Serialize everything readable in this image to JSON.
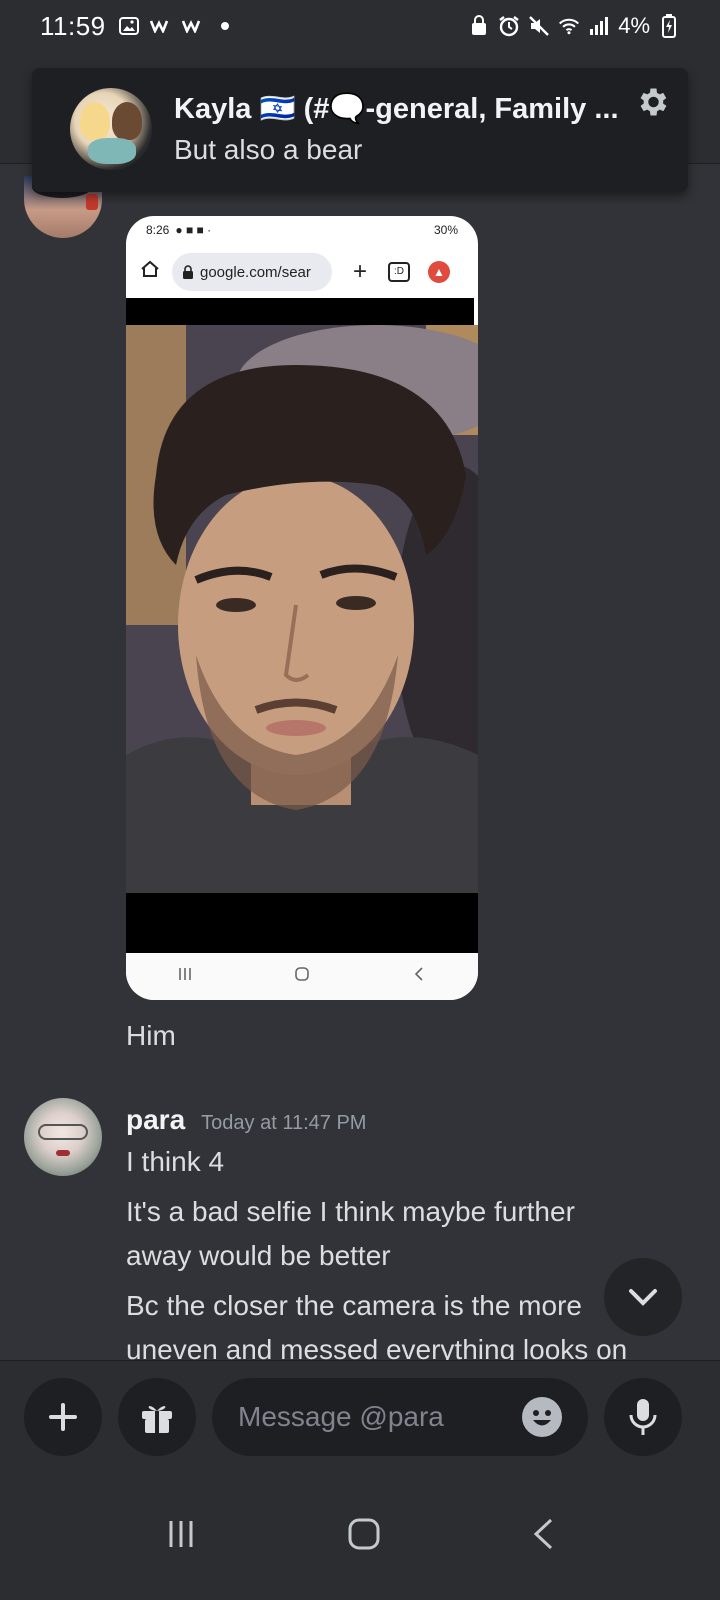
{
  "status_bar": {
    "time": "11:59",
    "battery": "4%"
  },
  "notification": {
    "title": "Kayla 🇮🇱 (#🗨️-general, Family ...",
    "body": "But also a bear"
  },
  "shared_image": {
    "status_time": "8:26",
    "status_battery": "30%",
    "url": "google.com/sear",
    "tabs_label": ":D"
  },
  "messages": {
    "caption": "Him",
    "para": {
      "author": "para",
      "timestamp": "Today at 11:47 PM",
      "lines": [
        "I think 4",
        "It's a bad selfie I think maybe further",
        "away would be better",
        "Bc the closer the camera is the more",
        "uneven and messed everything looks on"
      ]
    }
  },
  "composer": {
    "placeholder": "Message @para"
  },
  "colors": {
    "background": "#313338",
    "surface": "#2b2d31",
    "input": "#1e1f22",
    "text": "#dbdee1",
    "muted": "#949ba4"
  }
}
